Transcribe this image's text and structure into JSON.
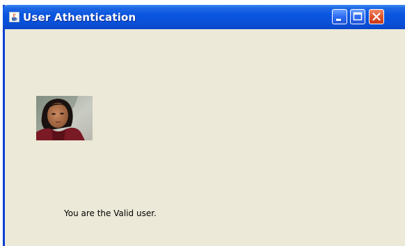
{
  "window": {
    "title": "User Athentication",
    "icon": "java-cup-icon"
  },
  "titlebar_buttons": {
    "minimize_icon": "minimize-icon",
    "maximize_icon": "maximize-icon",
    "close_icon": "close-icon"
  },
  "content": {
    "photo": "user-photo",
    "message": "You are the Valid user."
  },
  "colors": {
    "titlebar": "#0a4fd6",
    "window_background": "#ece9d8",
    "close_button": "#e0532c"
  }
}
